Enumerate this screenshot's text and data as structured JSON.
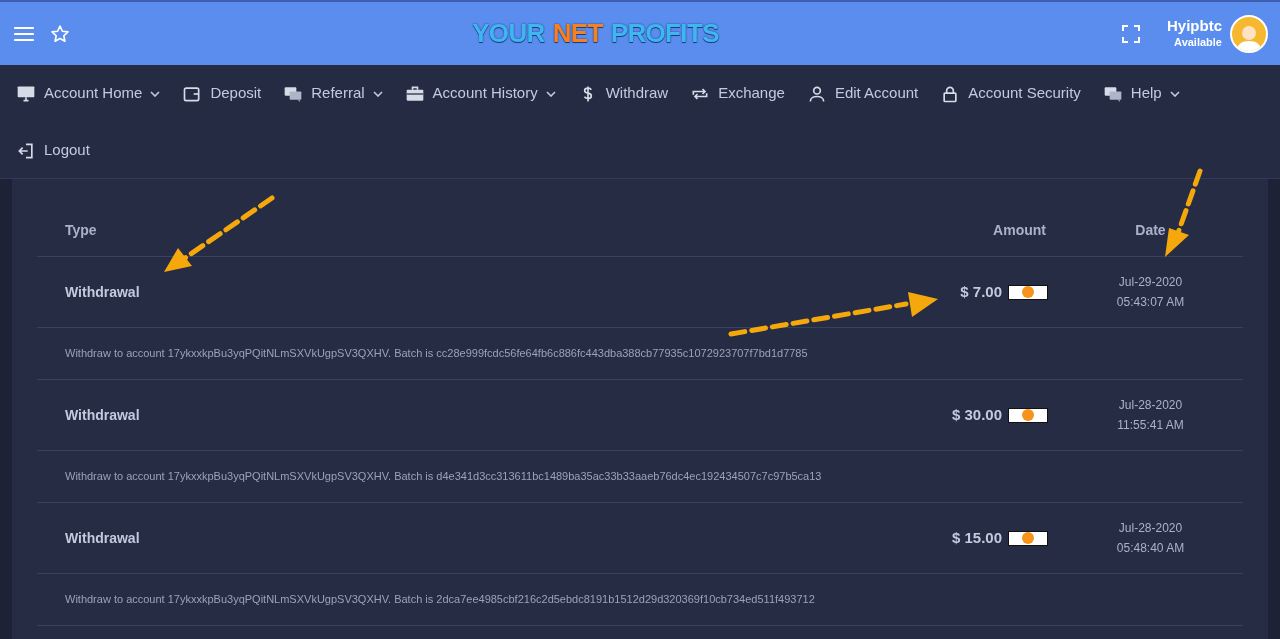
{
  "header": {
    "logo": [
      {
        "text": "YOUR",
        "color": "#3fb6f0"
      },
      {
        "text": "NET",
        "color": "#f7811e"
      },
      {
        "text": "PROFITS",
        "color": "#3fb6f0"
      }
    ],
    "user": {
      "name": "Hyipbtc",
      "status": "Available"
    }
  },
  "nav": [
    {
      "label": "Account Home",
      "kind": "monitor",
      "dropdown": true
    },
    {
      "label": "Deposit",
      "kind": "wallet",
      "dropdown": false
    },
    {
      "label": "Referral",
      "kind": "chat",
      "dropdown": true
    },
    {
      "label": "Account History",
      "kind": "briefcase",
      "dropdown": true
    },
    {
      "label": "Withdraw",
      "kind": "dollar",
      "dropdown": false
    },
    {
      "label": "Exchange",
      "kind": "exchange",
      "dropdown": false
    },
    {
      "label": "Edit Account",
      "kind": "user",
      "dropdown": false
    },
    {
      "label": "Account Security",
      "kind": "lock",
      "dropdown": false
    },
    {
      "label": "Help",
      "kind": "chat",
      "dropdown": true
    },
    {
      "label": "Logout",
      "kind": "logout",
      "dropdown": false
    }
  ],
  "table": {
    "columns": [
      "Type",
      "Amount",
      "Date"
    ],
    "rows": [
      {
        "type": "Withdrawal",
        "amount": "$ 7.00",
        "date": "Jul-29-2020",
        "time": "05:43:07 AM",
        "details": "Withdraw to account 17ykxxkpBu3yqPQitNLmSXVkUgpSV3QXHV. Batch is cc28e999fcdc56fe64fb6c886fc443dba388cb77935c1072923707f7bd1d7785"
      },
      {
        "type": "Withdrawal",
        "amount": "$ 30.00",
        "date": "Jul-28-2020",
        "time": "11:55:41 AM",
        "details": "Withdraw to account 17ykxxkpBu3yqPQitNLmSXVkUgpSV3QXHV. Batch is d4e341d3cc313611bc1489ba35ac33b33aaeb76dc4ec192434507c7c97b5ca13"
      },
      {
        "type": "Withdrawal",
        "amount": "$ 15.00",
        "date": "Jul-28-2020",
        "time": "05:48:40 AM",
        "details": "Withdraw to account 17ykxxkpBu3yqPQitNLmSXVkUgpSV3QXHV. Batch is 2dca7ee4985cbf216c2d5ebdc8191b1512d29d320369f10cb734ed511f493712"
      }
    ]
  }
}
